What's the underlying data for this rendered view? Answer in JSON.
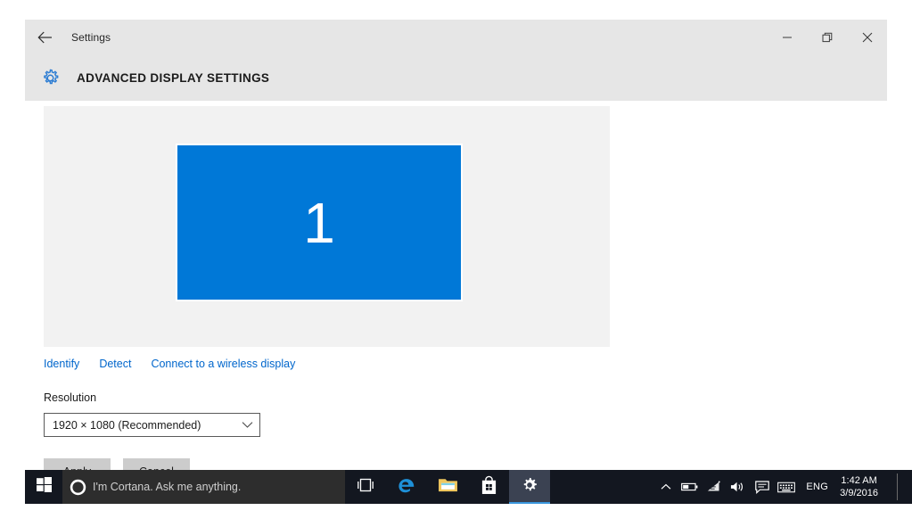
{
  "window": {
    "app_title": "Settings",
    "page_title": "ADVANCED DISPLAY SETTINGS",
    "back_icon": "back-arrow-icon",
    "header_icon": "gear-icon",
    "controls": {
      "minimize": "minimize-icon",
      "restore": "restore-icon",
      "close": "close-icon"
    }
  },
  "display_preview": {
    "monitor_number": "1"
  },
  "links": [
    {
      "label": "Identify",
      "name": "identify-link"
    },
    {
      "label": "Detect",
      "name": "detect-link"
    },
    {
      "label": "Connect to a wireless display",
      "name": "connect-wireless-display-link"
    }
  ],
  "resolution": {
    "label": "Resolution",
    "selected": "1920 × 1080 (Recommended)"
  },
  "buttons": {
    "apply": "Apply",
    "cancel": "Cancel"
  },
  "taskbar": {
    "start_icon": "windows-logo-icon",
    "cortana": {
      "icon": "cortana-circle-icon",
      "placeholder": "I'm Cortana. Ask me anything."
    },
    "taskview_icon": "task-view-icon",
    "apps": [
      {
        "name": "taskbar-app-edge",
        "icon": "edge-icon",
        "active": false
      },
      {
        "name": "taskbar-app-file-explorer",
        "icon": "folder-icon",
        "active": false
      },
      {
        "name": "taskbar-app-store",
        "icon": "store-bag-icon",
        "active": false
      },
      {
        "name": "taskbar-app-settings",
        "icon": "gear-icon",
        "active": true
      }
    ],
    "tray": {
      "chevron": "chevron-up-icon",
      "battery": "battery-icon",
      "wifi": "wifi-icon",
      "volume": "volume-icon",
      "action_center": "action-center-icon",
      "keyboard": "touch-keyboard-icon",
      "language": "ENG",
      "time": "1:42 AM",
      "date": "3/9/2016"
    }
  },
  "colors": {
    "accent_blue": "#0078d7",
    "link_blue": "#0066cc",
    "titlebar_gray": "#e6e6e6",
    "panel_gray": "#f2f2f2",
    "taskbar_dark": "#131720"
  }
}
